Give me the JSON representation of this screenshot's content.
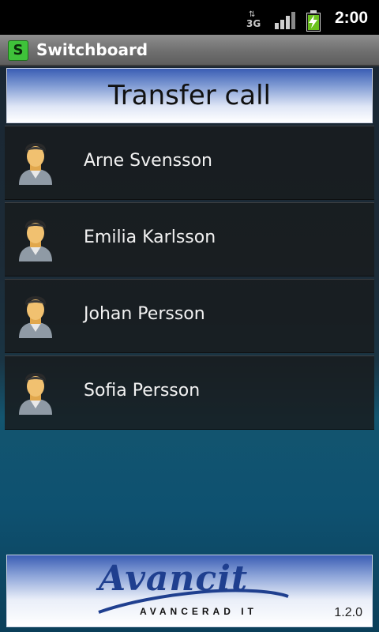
{
  "status_bar": {
    "network_label": "3G",
    "time": "2:00",
    "icons": [
      "data-transfer-icon",
      "signal-strength-icon",
      "battery-charging-icon"
    ],
    "battery_color": "#6bc11e"
  },
  "app_bar": {
    "icon_letter": "S",
    "title": "Switchboard",
    "icon_color": "#3fc23a"
  },
  "header": {
    "title": "Transfer call"
  },
  "contacts": [
    {
      "name": "Arne Svensson",
      "icon": "contact-avatar-icon"
    },
    {
      "name": "Emilia Karlsson",
      "icon": "contact-avatar-icon"
    },
    {
      "name": "Johan Persson",
      "icon": "contact-avatar-icon"
    },
    {
      "name": "Sofia Persson",
      "icon": "contact-avatar-icon"
    }
  ],
  "footer": {
    "logo_text": "Avancit",
    "logo_subtitle": "AVANCERAD IT",
    "version": "1.2.0",
    "brand_color": "#1f3f8f"
  }
}
